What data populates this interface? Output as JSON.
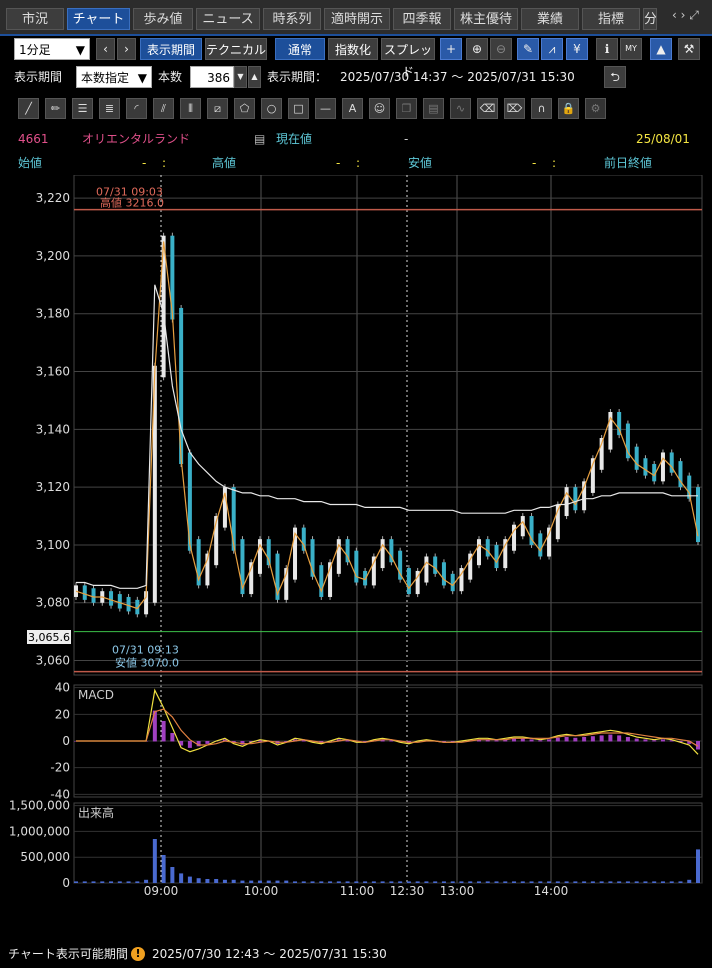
{
  "tabs": [
    "市況",
    "チャート",
    "歩み値",
    "ニュース",
    "時系列",
    "適時開示",
    "四季報",
    "株主優待",
    "業績",
    "指標"
  ],
  "tabs_active": 1,
  "tab_overflow_char": "分",
  "toolbar": {
    "interval": "1分足",
    "period_btn": "表示期間",
    "technical_btn": "テクニカル",
    "normal_btn": "通常",
    "index_btn": "指数化",
    "spread_btn": "スプレッド"
  },
  "row2": {
    "label_period": "表示期間",
    "mode": "本数指定",
    "label_count": "本数",
    "count": "386",
    "range_label": "表示期間：",
    "range": "2025/07/30 14:37 〜 2025/07/31 15:30"
  },
  "stock": {
    "code": "4661",
    "name": "オリエンタルランド",
    "current_label": "現在値",
    "current_value": "-",
    "date": "25/08/01",
    "open_label": "始値",
    "open_value": "-",
    "open_colon": ":",
    "high_label": "高値",
    "high_value": "-",
    "high_colon": ":",
    "low_label": "安値",
    "low_value": "-",
    "low_colon": ":",
    "prev_label": "前日終値"
  },
  "chart_data": [
    {
      "type": "line",
      "name": "price",
      "ylim": [
        3055,
        3228
      ],
      "yticks": [
        3220,
        3200,
        3180,
        3160,
        3140,
        3120,
        3100,
        3080,
        3060
      ],
      "ytick_labels": [
        "3,220",
        "3,200",
        "3,180",
        "3,160",
        "3,140",
        "3,120",
        "3,100",
        "3,080",
        "3,060"
      ],
      "high_annotation": {
        "time": "07/31 09:03",
        "label": "高値 3216.0",
        "value": 3216.0
      },
      "low_annotation": {
        "time": "07/31 09:13",
        "label": "安値 3070.0",
        "value": 3070.0
      },
      "last_price_label": "3,065.6",
      "series": [
        {
          "values": [
            3084,
            3083,
            3082,
            3082,
            3081,
            3080,
            3079,
            3078,
            3082,
            3160,
            3205,
            3180,
            3130,
            3100,
            3088,
            3095,
            3108,
            3118,
            3100,
            3085,
            3092,
            3100,
            3095,
            3083,
            3090,
            3104,
            3100,
            3091,
            3084,
            3092,
            3100,
            3096,
            3089,
            3088,
            3094,
            3100,
            3096,
            3090,
            3085,
            3089,
            3094,
            3092,
            3088,
            3086,
            3090,
            3095,
            3100,
            3098,
            3094,
            3100,
            3105,
            3108,
            3102,
            3098,
            3104,
            3112,
            3118,
            3114,
            3120,
            3128,
            3135,
            3144,
            3140,
            3132,
            3128,
            3126,
            3124,
            3130,
            3127,
            3122,
            3118,
            3103
          ]
        },
        {
          "values": [
            3087,
            3087,
            3086,
            3086,
            3086,
            3085,
            3085,
            3085,
            3086,
            3190,
            3180,
            3155,
            3140,
            3132,
            3128,
            3125,
            3122,
            3120,
            3119,
            3118,
            3118,
            3117,
            3117,
            3116,
            3116,
            3116,
            3115,
            3115,
            3115,
            3114,
            3114,
            3114,
            3114,
            3113,
            3113,
            3113,
            3113,
            3113,
            3112,
            3112,
            3112,
            3112,
            3112,
            3112,
            3111,
            3111,
            3111,
            3111,
            3111,
            3111,
            3112,
            3112,
            3112,
            3113,
            3113,
            3114,
            3114,
            3115,
            3116,
            3116,
            3117,
            3117,
            3118,
            3118,
            3118,
            3118,
            3118,
            3118,
            3117,
            3117,
            3117,
            3117
          ]
        }
      ]
    },
    {
      "type": "line",
      "name": "MACD",
      "title": "MACD",
      "ylim": [
        -42,
        42
      ],
      "yticks": [
        40,
        20,
        0,
        -20,
        -40
      ],
      "series": [
        {
          "values": [
            0,
            0,
            0,
            0,
            0,
            0,
            0,
            0,
            0,
            38,
            25,
            10,
            -5,
            -8,
            -6,
            -3,
            0,
            2,
            -2,
            -4,
            -1,
            1,
            0,
            -3,
            -1,
            2,
            1,
            -1,
            -2,
            0,
            2,
            1,
            -1,
            -1,
            1,
            2,
            1,
            -1,
            -2,
            0,
            1,
            0,
            -1,
            -1,
            0,
            1,
            2,
            2,
            1,
            2,
            3,
            3,
            2,
            1,
            2,
            4,
            5,
            4,
            5,
            6,
            7,
            8,
            7,
            5,
            3,
            2,
            1,
            2,
            1,
            -1,
            -3,
            -10
          ]
        },
        {
          "values": [
            0,
            0,
            0,
            0,
            0,
            0,
            0,
            0,
            0,
            22,
            24,
            18,
            8,
            1,
            -3,
            -3,
            -2,
            0,
            -1,
            -2,
            -2,
            -1,
            0,
            -1,
            -1,
            0,
            1,
            0,
            -1,
            -1,
            0,
            1,
            0,
            -1,
            0,
            1,
            1,
            0,
            -1,
            -1,
            0,
            0,
            -1,
            -1,
            -1,
            0,
            1,
            1,
            1,
            1,
            2,
            2,
            2,
            2,
            2,
            3,
            4,
            4,
            4,
            5,
            6,
            6,
            6,
            6,
            5,
            4,
            3,
            2,
            2,
            1,
            0,
            -4
          ]
        }
      ]
    },
    {
      "type": "bar",
      "name": "volume",
      "title": "出来高",
      "ylim": [
        0,
        1550000
      ],
      "yticks": [
        1500000,
        1000000,
        500000,
        0
      ],
      "ytick_labels": [
        "1,500,000",
        "1,000,000",
        "500,000",
        "0"
      ],
      "x": [
        "09:00",
        "10:00",
        "11:00",
        "12:30",
        "13:00",
        "14:00"
      ]
    }
  ],
  "navigator": {
    "ticks": [
      "13:00",
      "14:00",
      "09:00",
      "10:00",
      "11:00",
      "12:30",
      "13:00",
      "14:00"
    ]
  },
  "status": {
    "label": "チャート表示可能期間",
    "range": "2025/07/30 12:43 〜 2025/07/31 15:30"
  }
}
